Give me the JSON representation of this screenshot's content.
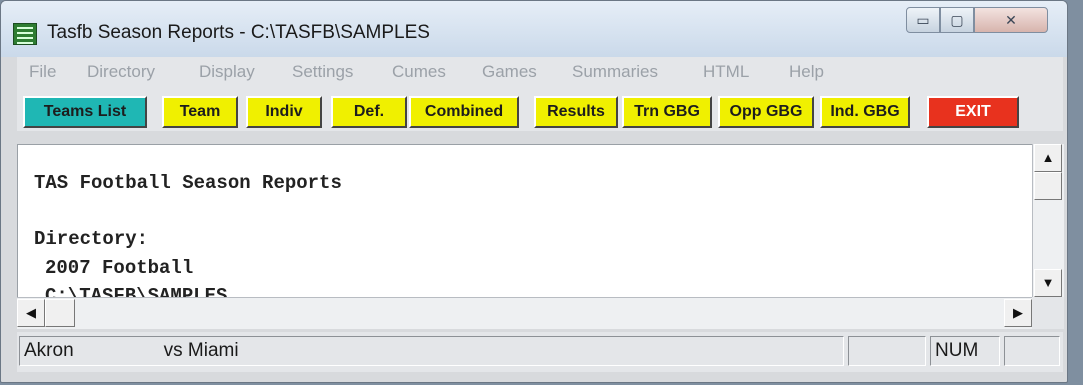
{
  "window": {
    "title": "Tasfb Season Reports - C:\\TASFB\\SAMPLES",
    "minimize_glyph": "▭",
    "maximize_glyph": "▢",
    "close_glyph": "✕"
  },
  "menu": [
    "File",
    "Directory",
    "Display",
    "Settings",
    "Cumes",
    "Games",
    "Summaries",
    "HTML",
    "Help"
  ],
  "toolbar": [
    {
      "label": "Teams List",
      "color": "#1fb7b4"
    },
    {
      "label": "Team",
      "color": "#f0f000"
    },
    {
      "label": "Indiv",
      "color": "#f0f000"
    },
    {
      "label": "Def.",
      "color": "#f0f000"
    },
    {
      "label": "Combined",
      "color": "#f0f000"
    },
    {
      "label": "Results",
      "color": "#f0f000"
    },
    {
      "label": "Trn GBG",
      "color": "#f0f000"
    },
    {
      "label": "Opp GBG",
      "color": "#f0f000"
    },
    {
      "label": "Ind. GBG",
      "color": "#f0f000"
    },
    {
      "label": "EXIT",
      "color": "#e8321e",
      "text_color": "#ffffff"
    }
  ],
  "report": {
    "heading": "TAS Football Season Reports",
    "dir_label": "Directory:",
    "season": "2007 Football",
    "path": "C:\\TASFB\\SAMPLES"
  },
  "scrollbar": {
    "up": "▲",
    "down": "▼",
    "left": "◀",
    "right": "▶"
  },
  "status": {
    "team": "Akron",
    "opponent": "vs Miami",
    "pane3": "",
    "num": "NUM",
    "pane5": ""
  }
}
